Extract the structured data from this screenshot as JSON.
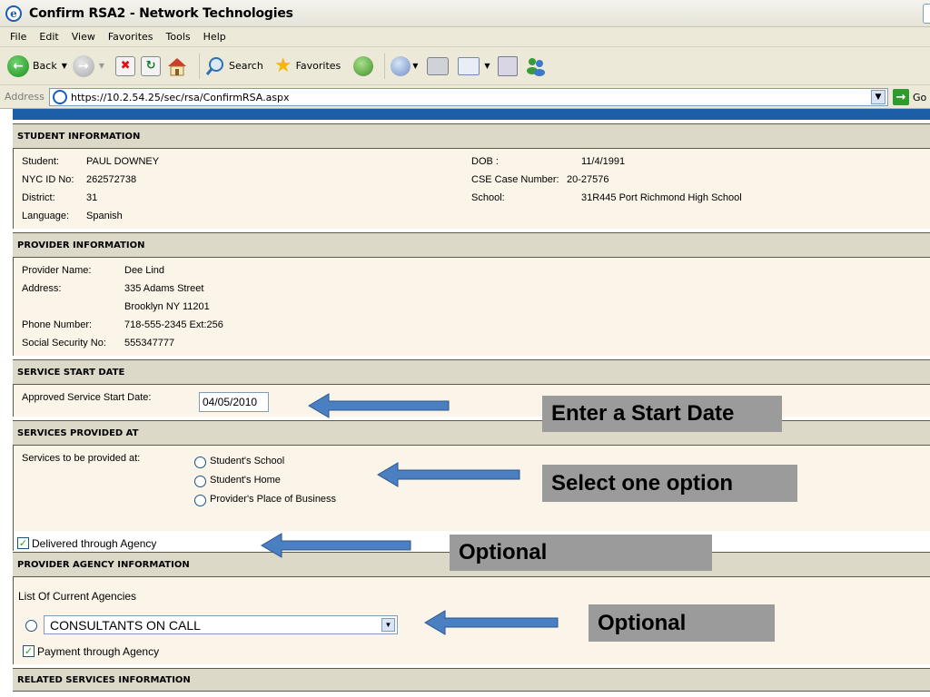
{
  "window": {
    "title": "Confirm RSA2 - Network Technologies"
  },
  "menu": [
    "File",
    "Edit",
    "View",
    "Favorites",
    "Tools",
    "Help"
  ],
  "toolbar": {
    "back": "Back",
    "search": "Search",
    "favorites": "Favorites"
  },
  "address": {
    "label": "Address",
    "url": "https://10.2.54.25/sec/rsa/ConfirmRSA.aspx",
    "go": "Go"
  },
  "student": {
    "header": "STUDENT INFORMATION",
    "student_label": "Student:",
    "student_value": "PAUL  DOWNEY",
    "nycid_label": "NYC ID No:",
    "nycid_value": "262572738",
    "district_label": "District:",
    "district_value": "31",
    "language_label": "Language:",
    "language_value": "Spanish",
    "dob_label": "DOB :",
    "dob_value": "11/4/1991",
    "cse_label": "CSE Case Number:",
    "cse_value": "20-27576",
    "school_label": "School:",
    "school_value": "31R445 Port Richmond High School"
  },
  "provider": {
    "header": "PROVIDER INFORMATION",
    "name_label": "Provider Name:",
    "name_value": "Dee Lind",
    "address_label": "Address:",
    "address_line1": "335 Adams Street",
    "address_line2": "Brooklyn NY 11201",
    "phone_label": "Phone Number:",
    "phone_value": "718-555-2345 Ext:256",
    "ssn_label": "Social Security No:",
    "ssn_value": "555347777"
  },
  "start_date": {
    "header": "SERVICE START DATE",
    "label": "Approved Service Start Date:",
    "value": "04/05/2010"
  },
  "services_at": {
    "header": "SERVICES PROVIDED AT",
    "label": "Services to be provided at:",
    "options": [
      "Student's School",
      "Student's Home",
      "Provider's Place of Business"
    ]
  },
  "agency": {
    "delivered_label": "Delivered through Agency",
    "delivered_checked": true,
    "header": "PROVIDER AGENCY INFORMATION",
    "list_label": "List Of Current Agencies",
    "selected_agency": "CONSULTANTS ON CALL",
    "payment_label": "Payment through Agency",
    "payment_checked": true
  },
  "related": {
    "header": "RELATED SERVICES INFORMATION"
  },
  "annotations": {
    "start_date": "Enter a Start Date",
    "services": "Select one option",
    "delivered": "Optional",
    "agency": "Optional"
  },
  "colors": {
    "section_header": "#ddd9c9",
    "section_body": "#fbf4e8",
    "arrow": "#4a7fc1",
    "callout": "#9b9b9b",
    "strip": "#1c5fa8"
  }
}
